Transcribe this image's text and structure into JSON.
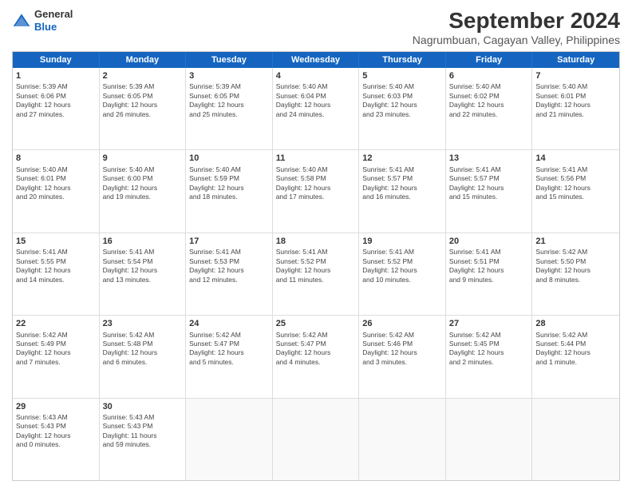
{
  "logo": {
    "general": "General",
    "blue": "Blue"
  },
  "title": "September 2024",
  "subtitle": "Nagrumbuan, Cagayan Valley, Philippines",
  "headers": [
    "Sunday",
    "Monday",
    "Tuesday",
    "Wednesday",
    "Thursday",
    "Friday",
    "Saturday"
  ],
  "rows": [
    [
      {
        "day": "1",
        "lines": [
          "Sunrise: 5:39 AM",
          "Sunset: 6:06 PM",
          "Daylight: 12 hours",
          "and 27 minutes."
        ]
      },
      {
        "day": "2",
        "lines": [
          "Sunrise: 5:39 AM",
          "Sunset: 6:05 PM",
          "Daylight: 12 hours",
          "and 26 minutes."
        ]
      },
      {
        "day": "3",
        "lines": [
          "Sunrise: 5:39 AM",
          "Sunset: 6:05 PM",
          "Daylight: 12 hours",
          "and 25 minutes."
        ]
      },
      {
        "day": "4",
        "lines": [
          "Sunrise: 5:40 AM",
          "Sunset: 6:04 PM",
          "Daylight: 12 hours",
          "and 24 minutes."
        ]
      },
      {
        "day": "5",
        "lines": [
          "Sunrise: 5:40 AM",
          "Sunset: 6:03 PM",
          "Daylight: 12 hours",
          "and 23 minutes."
        ]
      },
      {
        "day": "6",
        "lines": [
          "Sunrise: 5:40 AM",
          "Sunset: 6:02 PM",
          "Daylight: 12 hours",
          "and 22 minutes."
        ]
      },
      {
        "day": "7",
        "lines": [
          "Sunrise: 5:40 AM",
          "Sunset: 6:01 PM",
          "Daylight: 12 hours",
          "and 21 minutes."
        ]
      }
    ],
    [
      {
        "day": "8",
        "lines": [
          "Sunrise: 5:40 AM",
          "Sunset: 6:01 PM",
          "Daylight: 12 hours",
          "and 20 minutes."
        ]
      },
      {
        "day": "9",
        "lines": [
          "Sunrise: 5:40 AM",
          "Sunset: 6:00 PM",
          "Daylight: 12 hours",
          "and 19 minutes."
        ]
      },
      {
        "day": "10",
        "lines": [
          "Sunrise: 5:40 AM",
          "Sunset: 5:59 PM",
          "Daylight: 12 hours",
          "and 18 minutes."
        ]
      },
      {
        "day": "11",
        "lines": [
          "Sunrise: 5:40 AM",
          "Sunset: 5:58 PM",
          "Daylight: 12 hours",
          "and 17 minutes."
        ]
      },
      {
        "day": "12",
        "lines": [
          "Sunrise: 5:41 AM",
          "Sunset: 5:57 PM",
          "Daylight: 12 hours",
          "and 16 minutes."
        ]
      },
      {
        "day": "13",
        "lines": [
          "Sunrise: 5:41 AM",
          "Sunset: 5:57 PM",
          "Daylight: 12 hours",
          "and 15 minutes."
        ]
      },
      {
        "day": "14",
        "lines": [
          "Sunrise: 5:41 AM",
          "Sunset: 5:56 PM",
          "Daylight: 12 hours",
          "and 15 minutes."
        ]
      }
    ],
    [
      {
        "day": "15",
        "lines": [
          "Sunrise: 5:41 AM",
          "Sunset: 5:55 PM",
          "Daylight: 12 hours",
          "and 14 minutes."
        ]
      },
      {
        "day": "16",
        "lines": [
          "Sunrise: 5:41 AM",
          "Sunset: 5:54 PM",
          "Daylight: 12 hours",
          "and 13 minutes."
        ]
      },
      {
        "day": "17",
        "lines": [
          "Sunrise: 5:41 AM",
          "Sunset: 5:53 PM",
          "Daylight: 12 hours",
          "and 12 minutes."
        ]
      },
      {
        "day": "18",
        "lines": [
          "Sunrise: 5:41 AM",
          "Sunset: 5:52 PM",
          "Daylight: 12 hours",
          "and 11 minutes."
        ]
      },
      {
        "day": "19",
        "lines": [
          "Sunrise: 5:41 AM",
          "Sunset: 5:52 PM",
          "Daylight: 12 hours",
          "and 10 minutes."
        ]
      },
      {
        "day": "20",
        "lines": [
          "Sunrise: 5:41 AM",
          "Sunset: 5:51 PM",
          "Daylight: 12 hours",
          "and 9 minutes."
        ]
      },
      {
        "day": "21",
        "lines": [
          "Sunrise: 5:42 AM",
          "Sunset: 5:50 PM",
          "Daylight: 12 hours",
          "and 8 minutes."
        ]
      }
    ],
    [
      {
        "day": "22",
        "lines": [
          "Sunrise: 5:42 AM",
          "Sunset: 5:49 PM",
          "Daylight: 12 hours",
          "and 7 minutes."
        ]
      },
      {
        "day": "23",
        "lines": [
          "Sunrise: 5:42 AM",
          "Sunset: 5:48 PM",
          "Daylight: 12 hours",
          "and 6 minutes."
        ]
      },
      {
        "day": "24",
        "lines": [
          "Sunrise: 5:42 AM",
          "Sunset: 5:47 PM",
          "Daylight: 12 hours",
          "and 5 minutes."
        ]
      },
      {
        "day": "25",
        "lines": [
          "Sunrise: 5:42 AM",
          "Sunset: 5:47 PM",
          "Daylight: 12 hours",
          "and 4 minutes."
        ]
      },
      {
        "day": "26",
        "lines": [
          "Sunrise: 5:42 AM",
          "Sunset: 5:46 PM",
          "Daylight: 12 hours",
          "and 3 minutes."
        ]
      },
      {
        "day": "27",
        "lines": [
          "Sunrise: 5:42 AM",
          "Sunset: 5:45 PM",
          "Daylight: 12 hours",
          "and 2 minutes."
        ]
      },
      {
        "day": "28",
        "lines": [
          "Sunrise: 5:42 AM",
          "Sunset: 5:44 PM",
          "Daylight: 12 hours",
          "and 1 minute."
        ]
      }
    ],
    [
      {
        "day": "29",
        "lines": [
          "Sunrise: 5:43 AM",
          "Sunset: 5:43 PM",
          "Daylight: 12 hours",
          "and 0 minutes."
        ]
      },
      {
        "day": "30",
        "lines": [
          "Sunrise: 5:43 AM",
          "Sunset: 5:43 PM",
          "Daylight: 11 hours",
          "and 59 minutes."
        ]
      },
      {
        "day": "",
        "lines": []
      },
      {
        "day": "",
        "lines": []
      },
      {
        "day": "",
        "lines": []
      },
      {
        "day": "",
        "lines": []
      },
      {
        "day": "",
        "lines": []
      }
    ]
  ]
}
